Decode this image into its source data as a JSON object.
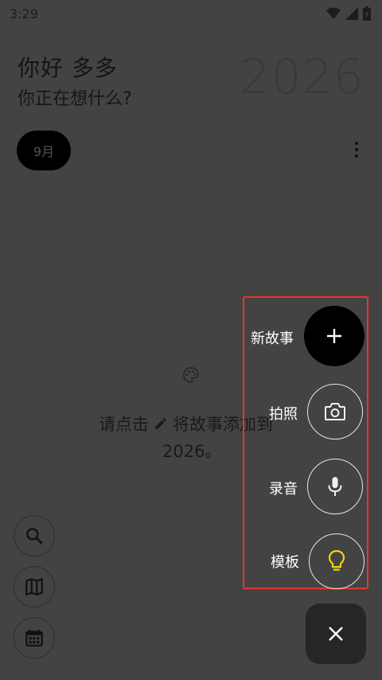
{
  "status_bar": {
    "time": "3:29",
    "icons": [
      "wifi-icon",
      "signal-icon",
      "battery-icon"
    ]
  },
  "header": {
    "greeting": "你好 多多",
    "subtitle": "你正在想什么?",
    "year": "2026"
  },
  "filter": {
    "month_chip": "9月",
    "more_icon": "more-vert-icon"
  },
  "empty_state": {
    "icon": "palette-icon",
    "line1_prefix": "请点击",
    "line1_icon": "pencil-icon",
    "line1_suffix": "将故事添加到",
    "line2": "2026。"
  },
  "side_buttons": [
    {
      "icon": "search-icon"
    },
    {
      "icon": "map-icon"
    },
    {
      "icon": "calendar-icon"
    }
  ],
  "fab_menu": {
    "items": [
      {
        "label": "新故事",
        "icon": "plus-icon"
      },
      {
        "label": "拍照",
        "icon": "camera-icon"
      },
      {
        "label": "录音",
        "icon": "microphone-icon"
      },
      {
        "label": "模板",
        "icon": "lightbulb-icon"
      }
    ],
    "close_icon": "close-icon"
  },
  "colors": {
    "background": "#434343",
    "highlight_border": "#e6372a",
    "lightbulb": "#f2d40c"
  }
}
